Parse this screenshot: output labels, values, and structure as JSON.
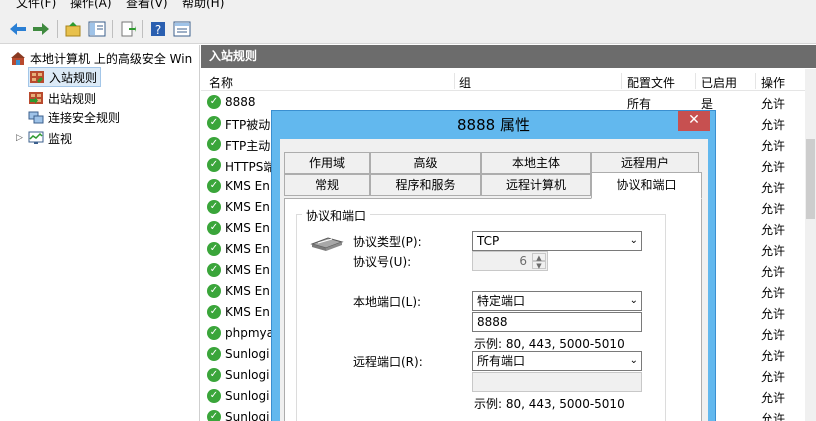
{
  "menu": [
    "文件(F)",
    "操作(A)",
    "查看(V)",
    "帮助(H)"
  ],
  "tree": {
    "root": "本地计算机 上的高级安全 Win",
    "items": [
      "入站规则",
      "出站规则",
      "连接安全规则",
      "监视"
    ]
  },
  "panel": {
    "title": "入站规则",
    "columns": [
      "名称",
      "组",
      "配置文件",
      "已启用",
      "操作"
    ],
    "rows": [
      {
        "name": "8888",
        "profile": "所有",
        "enabled": "是",
        "action": "允许"
      },
      {
        "name": "FTP被动",
        "action": "允许"
      },
      {
        "name": "FTP主动",
        "action": "允许"
      },
      {
        "name": "HTTPS端",
        "action": "允许"
      },
      {
        "name": "KMS En",
        "action": "允许"
      },
      {
        "name": "KMS En",
        "action": "允许"
      },
      {
        "name": "KMS En",
        "action": "允许"
      },
      {
        "name": "KMS En",
        "action": "允许"
      },
      {
        "name": "KMS En",
        "action": "允许"
      },
      {
        "name": "KMS En",
        "action": "允许"
      },
      {
        "name": "KMS En",
        "action": "允许"
      },
      {
        "name": "phpmya",
        "action": "允许"
      },
      {
        "name": "Sunlogi",
        "action": "允许"
      },
      {
        "name": "Sunlogi",
        "action": "允许"
      },
      {
        "name": "Sunlogi",
        "action": "允许"
      },
      {
        "name": "Sunlogi",
        "action": "允许"
      }
    ]
  },
  "dialog": {
    "title": "8888 属性",
    "close": "✕",
    "tabs_row1": [
      "作用域",
      "高级",
      "本地主体",
      "远程用户"
    ],
    "tabs_row2": [
      "常规",
      "程序和服务",
      "远程计算机",
      "协议和端口"
    ],
    "group_title": "协议和端口",
    "protocol_type_label": "协议类型(P):",
    "protocol_type_value": "TCP",
    "protocol_number_label": "协议号(U):",
    "protocol_number_value": "6",
    "local_port_label": "本地端口(L):",
    "local_port_value": "特定端口",
    "local_port_input": "8888",
    "local_example": "示例: 80, 443, 5000-5010",
    "remote_port_label": "远程端口(R):",
    "remote_port_value": "所有端口",
    "remote_port_input": "",
    "remote_example": "示例: 80, 443, 5000-5010"
  }
}
